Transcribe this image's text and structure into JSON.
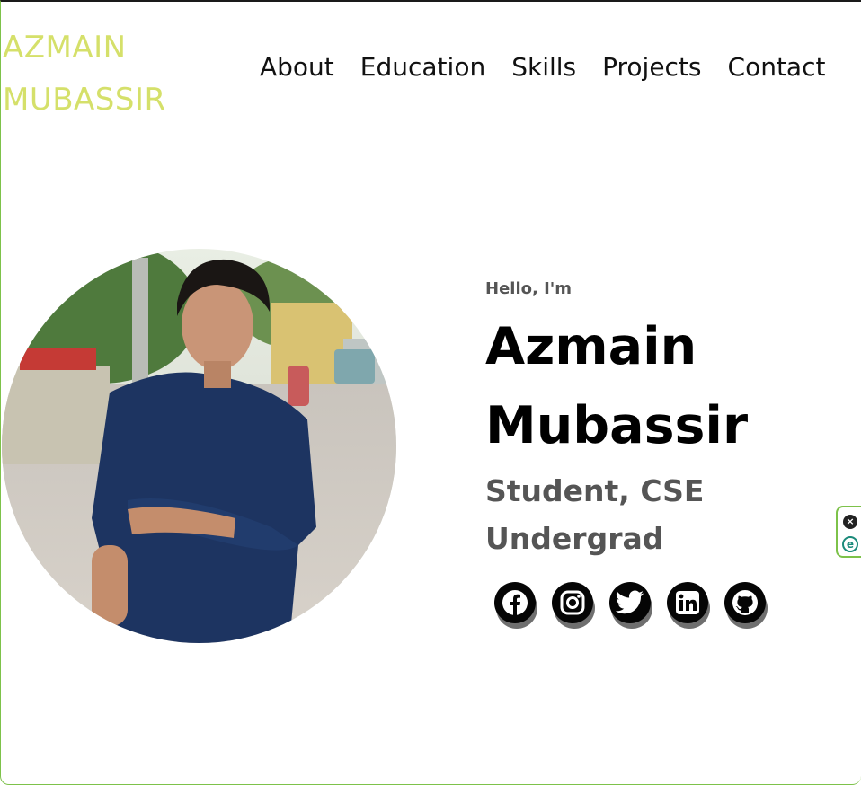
{
  "header": {
    "logo_line1": "AZMAIN",
    "logo_line2": "MUBASSIR",
    "nav": [
      "About",
      "Education",
      "Skills",
      "Projects",
      "Contact"
    ]
  },
  "hero": {
    "greeting": "Hello, I'm",
    "name_line1": "Azmain",
    "name_line2": "Mubassir",
    "role_line1": "Student, CSE",
    "role_line2": "Undergrad",
    "photo_alt": "profile-photo"
  },
  "socials": [
    {
      "icon": "facebook-icon"
    },
    {
      "icon": "instagram-icon"
    },
    {
      "icon": "twitter-icon"
    },
    {
      "icon": "linkedin-icon"
    },
    {
      "icon": "github-icon"
    }
  ],
  "widget": {
    "close_glyph": "×",
    "e_glyph": "e"
  },
  "colors": {
    "logo": "#d5e06a",
    "text": "#111111",
    "subtle": "#555555",
    "frame": "#7dc24a"
  }
}
